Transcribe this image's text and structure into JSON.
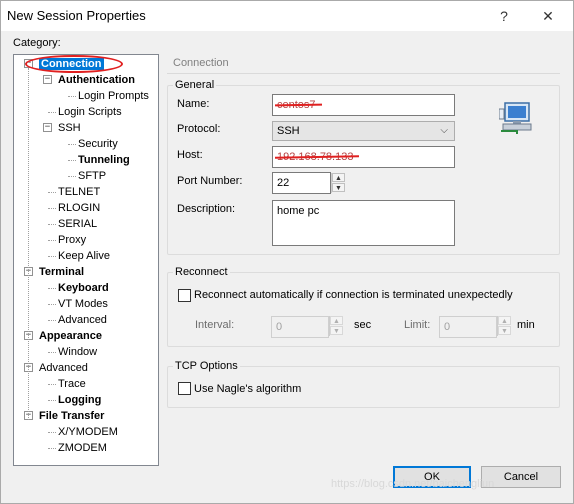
{
  "window": {
    "title": "New Session Properties",
    "help_glyph": "?",
    "close_glyph": "✕"
  },
  "category_label": "Category:",
  "tree": [
    {
      "label": "Connection",
      "bold": true,
      "selected": true,
      "level": 0,
      "expander": "−"
    },
    {
      "label": "Authentication",
      "bold": true,
      "level": 1,
      "expander": "−"
    },
    {
      "label": "Login Prompts",
      "bold": false,
      "level": 2
    },
    {
      "label": "Login Scripts",
      "bold": false,
      "level": 1
    },
    {
      "label": "SSH",
      "bold": false,
      "level": 1,
      "expander": "−"
    },
    {
      "label": "Security",
      "bold": false,
      "level": 2
    },
    {
      "label": "Tunneling",
      "bold": true,
      "level": 2
    },
    {
      "label": "SFTP",
      "bold": false,
      "level": 2
    },
    {
      "label": "TELNET",
      "bold": false,
      "level": 1
    },
    {
      "label": "RLOGIN",
      "bold": false,
      "level": 1
    },
    {
      "label": "SERIAL",
      "bold": false,
      "level": 1
    },
    {
      "label": "Proxy",
      "bold": false,
      "level": 1
    },
    {
      "label": "Keep Alive",
      "bold": false,
      "level": 1
    },
    {
      "label": "Terminal",
      "bold": true,
      "level": 0,
      "expander": "−"
    },
    {
      "label": "Keyboard",
      "bold": true,
      "level": 1
    },
    {
      "label": "VT Modes",
      "bold": false,
      "level": 1
    },
    {
      "label": "Advanced",
      "bold": false,
      "level": 1
    },
    {
      "label": "Appearance",
      "bold": true,
      "level": 0,
      "expander": "−"
    },
    {
      "label": "Window",
      "bold": false,
      "level": 1
    },
    {
      "label": "Advanced",
      "bold": false,
      "level": 0,
      "expander": "−"
    },
    {
      "label": "Trace",
      "bold": false,
      "level": 1
    },
    {
      "label": "Logging",
      "bold": true,
      "level": 1
    },
    {
      "label": "File Transfer",
      "bold": true,
      "level": 0,
      "expander": "−"
    },
    {
      "label": "X/YMODEM",
      "bold": false,
      "level": 1
    },
    {
      "label": "ZMODEM",
      "bold": false,
      "level": 1
    }
  ],
  "panel": {
    "header": "Connection",
    "general": {
      "title": "General",
      "name_label": "Name:",
      "name_value": "centos7",
      "protocol_label": "Protocol:",
      "protocol_value": "SSH",
      "host_label": "Host:",
      "host_value": "192.168.78.133",
      "port_label": "Port Number:",
      "port_value": "22",
      "description_label": "Description:",
      "description_value": "home pc"
    },
    "reconnect": {
      "title": "Reconnect",
      "checkbox_label": "Reconnect automatically if connection is terminated unexpectedly",
      "checked": false,
      "interval_label": "Interval:",
      "interval_value": "0",
      "interval_unit": "sec",
      "limit_label": "Limit:",
      "limit_value": "0",
      "limit_unit": "min"
    },
    "tcp": {
      "title": "TCP Options",
      "nagle_label": "Use Nagle's algorithm",
      "checked": false
    }
  },
  "buttons": {
    "ok": "OK",
    "cancel": "Cancel"
  },
  "watermark": "https://blog.csdn.net/baichengliun",
  "icons": {
    "network": "network-computer-icon",
    "spin_up": "▲",
    "spin_down": "▼",
    "chevron": "⌵"
  },
  "colors": {
    "selection": "#0078d7",
    "annotation_red": "#e02020"
  }
}
